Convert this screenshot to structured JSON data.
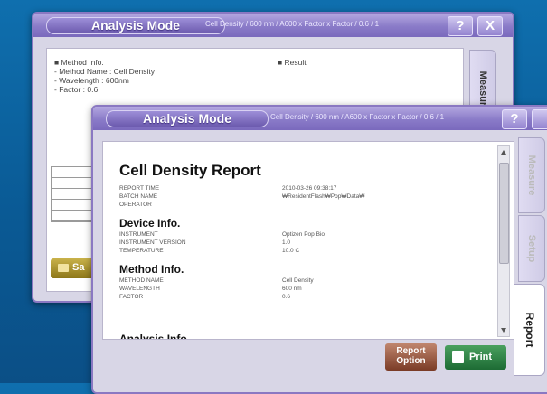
{
  "back_window": {
    "title": "Analysis Mode",
    "path": "Cell Density / 600 nm / A600 x Factor x Factor / 0.6 / 1",
    "help": "?",
    "close": "X",
    "method_info": {
      "heading": "■ Method Info.",
      "lines": [
        "- Method Name : Cell Density",
        "- Wavelength : 600nm",
        "- Factor : 0.6"
      ]
    },
    "result_heading": "■ Result",
    "tab_measure": "Measure",
    "save_partial": "Sa"
  },
  "front_window": {
    "title": "Analysis Mode",
    "path": "Cell Density / 600 nm / A600 x Factor x Factor / 0.6 / 1",
    "help": "?",
    "tabs": [
      "Measure",
      "Setup",
      "Report"
    ],
    "report": {
      "title": "Cell Density Report",
      "header_rows": [
        {
          "label": "REPORT TIME",
          "value": "2010-03-26 09:38:17"
        },
        {
          "label": "BATCH NAME",
          "value": "₩ResidentFlash₩Pop₩Data₩"
        },
        {
          "label": "OPERATOR",
          "value": ""
        }
      ],
      "device_heading": "Device Info.",
      "device_rows": [
        {
          "label": "INSTRUMENT",
          "value": "Optizen Pop Bio"
        },
        {
          "label": "INSTRUMENT VERSION",
          "value": "1.0"
        },
        {
          "label": "TEMPERATURE",
          "value": "10.0 C"
        }
      ],
      "method_heading": "Method Info.",
      "method_rows": [
        {
          "label": "METHOD NAME",
          "value": "Cell Density"
        },
        {
          "label": "WAVELENGTH",
          "value": "600 nm"
        },
        {
          "label": "FACTOR",
          "value": "0.6"
        }
      ],
      "cutoff_heading": "Analysis Info."
    },
    "buttons": {
      "report_option_line1": "Report",
      "report_option_line2": "Option",
      "print": "Print"
    }
  }
}
